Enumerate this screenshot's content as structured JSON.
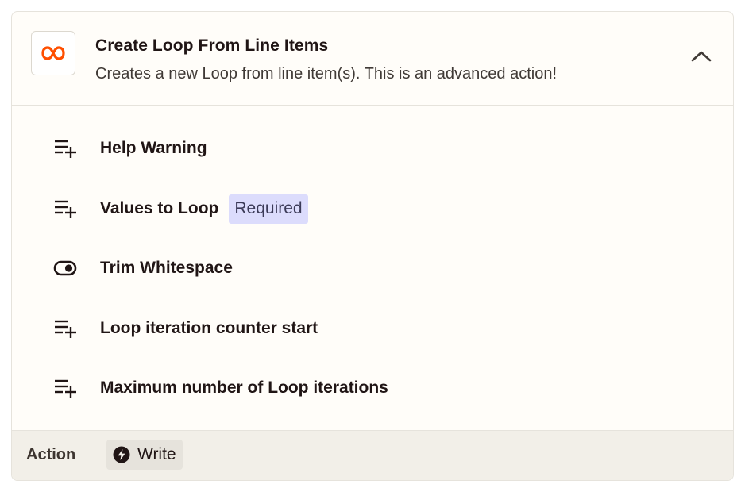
{
  "step": {
    "title": "Create Loop From Line Items",
    "description": "Creates a new Loop from line item(s). This is an advanced action!",
    "app_icon": "loop-infinity-icon",
    "collapse_icon": "chevron-up-icon"
  },
  "fields": [
    {
      "label": "Help Warning",
      "icon": "list-add-icon",
      "required": false
    },
    {
      "label": "Values to Loop",
      "icon": "list-add-icon",
      "required": true,
      "badge": "Required"
    },
    {
      "label": "Trim Whitespace",
      "icon": "toggle-icon",
      "required": false
    },
    {
      "label": "Loop iteration counter start",
      "icon": "list-add-icon",
      "required": false
    },
    {
      "label": "Maximum number of Loop iterations",
      "icon": "list-add-icon",
      "required": false
    }
  ],
  "footer": {
    "label": "Action",
    "type_label": "Write",
    "type_icon": "bolt-icon"
  },
  "colors": {
    "brand_orange": "#ff4f00",
    "required_badge_bg": "#dcdcfc",
    "footer_bg": "#f2efe8",
    "card_bg": "#fffdf9"
  }
}
